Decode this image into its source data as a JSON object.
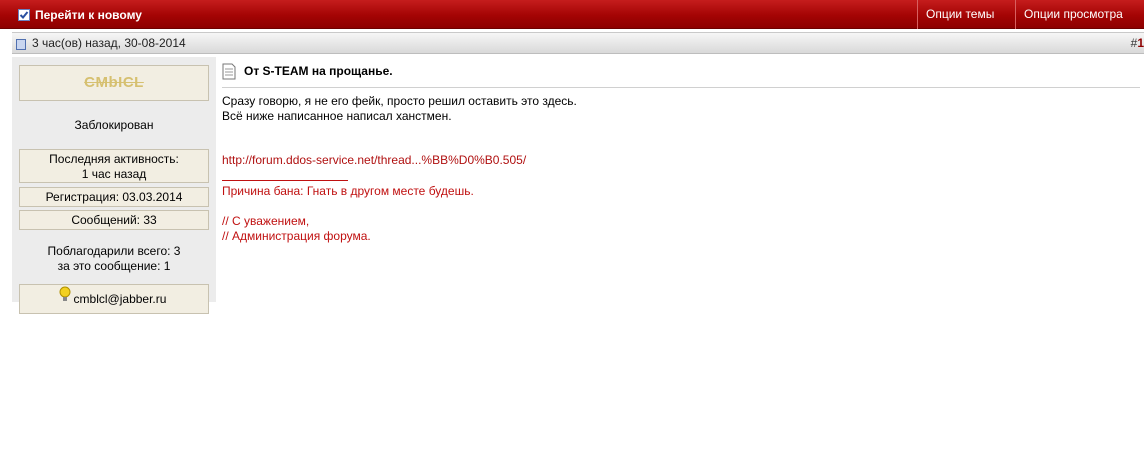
{
  "navbar": {
    "goto_new": "Перейти к новому",
    "thread_options": "Опции темы",
    "view_options": "Опции просмотра"
  },
  "post_header": {
    "date": "3 час(ов) назад, 30-08-2014",
    "number_hash": "#",
    "number": "1"
  },
  "user": {
    "name": "CMbICL",
    "status": "Заблокирован",
    "last_activity_label": "Последняя активность:",
    "last_activity_value": "1 час назад",
    "registration": "Регистрация: 03.03.2014",
    "messages": "Сообщений: 33",
    "thanks_total": "Поблагодарили всего: 3",
    "thanks_post": "за это сообщение: 1",
    "jabber": "cmblcl@jabber.ru"
  },
  "post": {
    "title": "От S-TEAM на прощанье.",
    "line1": "Сразу говорю, я не его фейк, просто решил оставить это здесь.",
    "line2": "Всё ниже написанное написал ханстмен.",
    "link": "http://forum.ddos-service.net/thread...%BB%D0%B0.505/",
    "ban_reason": "Причина бана: Гнать в другом месте будешь.",
    "sig1": "// С уважением,",
    "sig2": "// Администрация форума."
  },
  "colors": {
    "navbar": "#a40404",
    "accent_red": "#c01010"
  },
  "icons": [
    "checkbox-icon",
    "chevron-down-icon",
    "post-icon",
    "document-icon",
    "lightbulb-icon"
  ]
}
